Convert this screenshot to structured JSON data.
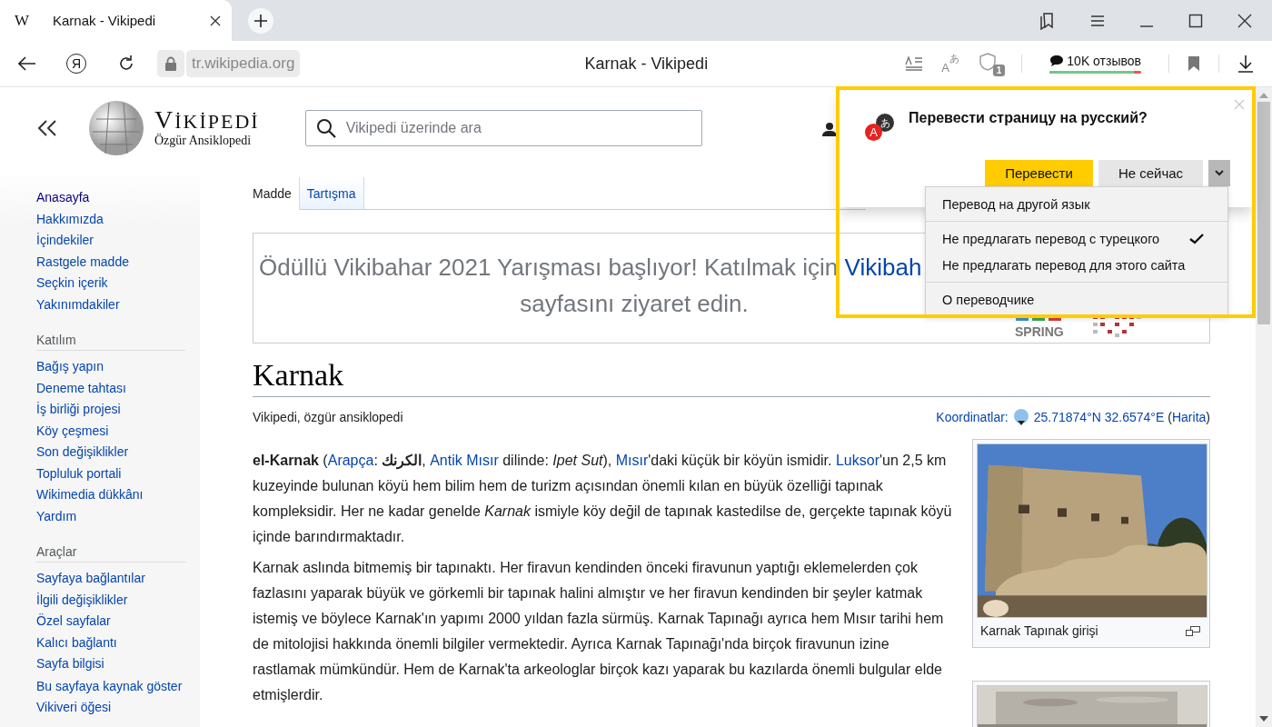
{
  "browser_tab": {
    "favicon": "W",
    "title": "Karnak - Vikipedi",
    "selected": true
  },
  "toolbar": {
    "logo_letter": "Я",
    "address": "tr.wikipedia.org",
    "page_title": "Karnak - Vikipedi",
    "translate_glyphs": [
      "A",
      "あ"
    ],
    "shield_badge": "1",
    "reviews": {
      "label": "10K отзывов",
      "level": 0.92
    }
  },
  "wiki_header": {
    "wordmark": "VİKİPEDİ",
    "tagline": "Özgür Ansiklopedi",
    "search": {
      "placeholder": "Vikipedi üzerinde ara"
    }
  },
  "sidebar": {
    "sections": [
      {
        "items": [
          {
            "label": "Anasayfa",
            "visited": true
          },
          {
            "label": "Hakkımızda",
            "visited": false
          },
          {
            "label": "İçindekiler",
            "visited": false
          },
          {
            "label": "Rastgele madde",
            "visited": false
          },
          {
            "label": "Seçkin içerik",
            "visited": false
          },
          {
            "label": "Yakınımdakiler",
            "visited": false
          }
        ]
      },
      {
        "heading": "Katılım",
        "items": [
          {
            "label": "Bağış yapın",
            "visited": false
          },
          {
            "label": "Deneme tahtası",
            "visited": false
          },
          {
            "label": "İş birliği projesi",
            "visited": false
          },
          {
            "label": "Köy çeşmesi",
            "visited": false
          },
          {
            "label": "Son değişiklikler",
            "visited": false
          },
          {
            "label": "Topluluk portali",
            "visited": false
          },
          {
            "label": "Wikimedia dükkânı",
            "visited": false
          },
          {
            "label": "Yardım",
            "visited": false
          }
        ]
      },
      {
        "heading": "Araçlar",
        "items": [
          {
            "label": "Sayfaya bağlantılar",
            "visited": false
          },
          {
            "label": "İlgili değişiklikler",
            "visited": false
          },
          {
            "label": "Özel sayfalar",
            "visited": false
          },
          {
            "label": "Kalıcı bağlantı",
            "visited": false
          },
          {
            "label": "Sayfa bilgisi",
            "visited": false
          },
          {
            "label": "Bu sayfaya kaynak göster",
            "visited": false
          },
          {
            "label": "Vikiveri öğesi",
            "visited": false
          }
        ]
      }
    ]
  },
  "page_tabs": [
    {
      "label": "Madde",
      "selected": true
    },
    {
      "label": "Tartışma",
      "selected": false
    }
  ],
  "banner": {
    "line_1": "Ödüllü Vikibahar 2021 Yarışması başlıyor! Katılmak için ",
    "link": "Vikibah",
    "line_2": "sayfasını ziyaret edin.",
    "logo_text": "SPRING"
  },
  "article": {
    "title": "Karnak",
    "subtitle": "Vikipedi, özgür ansiklopedi",
    "coordinates": {
      "label": "Koordinatlar:",
      "value": "25.71874°N 32.6574°E",
      "open": "(",
      "map_link": "Harita",
      "close": ")"
    },
    "paragraphs": [
      [
        {
          "kind": "bold",
          "text": "el-Karnak"
        },
        {
          "kind": "text",
          "text": " ("
        },
        {
          "kind": "link",
          "text": "Arapça"
        },
        {
          "kind": "text",
          "text": ": "
        },
        {
          "kind": "bold",
          "text": "الكرنك"
        },
        {
          "kind": "text",
          "text": ", "
        },
        {
          "kind": "link",
          "text": "Antik Mısır"
        },
        {
          "kind": "text",
          "text": " dilinde: "
        },
        {
          "kind": "italic",
          "text": "Ipet Sut"
        },
        {
          "kind": "text",
          "text": "), "
        },
        {
          "kind": "link",
          "text": "Mısır"
        },
        {
          "kind": "text",
          "text": "'daki küçük bir köyün ismidir. "
        },
        {
          "kind": "link",
          "text": "Luksor"
        },
        {
          "kind": "text",
          "text": "'un 2,5 km kuzeyinde bulunan köyü hem bilim hem de turizm açısından önemli kılan en büyük özelliği tapınak kompleksidir. Her ne kadar genelde "
        },
        {
          "kind": "italic",
          "text": "Karnak"
        },
        {
          "kind": "text",
          "text": " ismiyle köy değil de tapınak kastedilse de, gerçekte tapınak köyü içinde barındırmaktadır."
        }
      ],
      [
        {
          "kind": "text",
          "text": "Karnak aslında bitmemiş bir tapınaktı. Her firavun kendinden önceki firavunun yaptığı eklemelerden çok fazlasını yaparak büyük ve görkemli bir tapınak halini almıştır ve her firavun kendinden bir şeyler katmak istemiş ve böylece Karnak'ın yapımı 2000 yıldan fazla sürmüş. Karnak Tapınağı ayrıca hem Mısır tarihi hem de mitolojisi hakkında önemli bilgiler vermektedir. Ayrıca Karnak Tapınağı'nda birçok firavunun izine rastlamak mümkündür. Hem de Karnak'ta arkeologlar birçok kazı yaparak bu kazılarda önemli bulgular elde etmişlerdir."
        }
      ]
    ],
    "figures": [
      {
        "kind": "picture",
        "caption": "Karnak Tapınak girişi"
      },
      {
        "kind": "picture"
      }
    ]
  },
  "translate_popup": {
    "icon_glyphs": [
      "あ",
      "A"
    ],
    "title": "Перевести страницу на русский?",
    "translate_button": "Перевести",
    "later_button": "Не сейчас",
    "menu_expanded": true,
    "menu": [
      {
        "items": [
          {
            "label": "Перевод на другой язык",
            "checked": false
          }
        ]
      },
      {
        "items": [
          {
            "label": "Не предлагать перевод с турецкого",
            "checked": true
          },
          {
            "label": "Не предлагать перевод для этого сайта",
            "checked": false
          }
        ]
      },
      {
        "items": [
          {
            "label": "О переводчике",
            "checked": false
          }
        ]
      }
    ]
  }
}
